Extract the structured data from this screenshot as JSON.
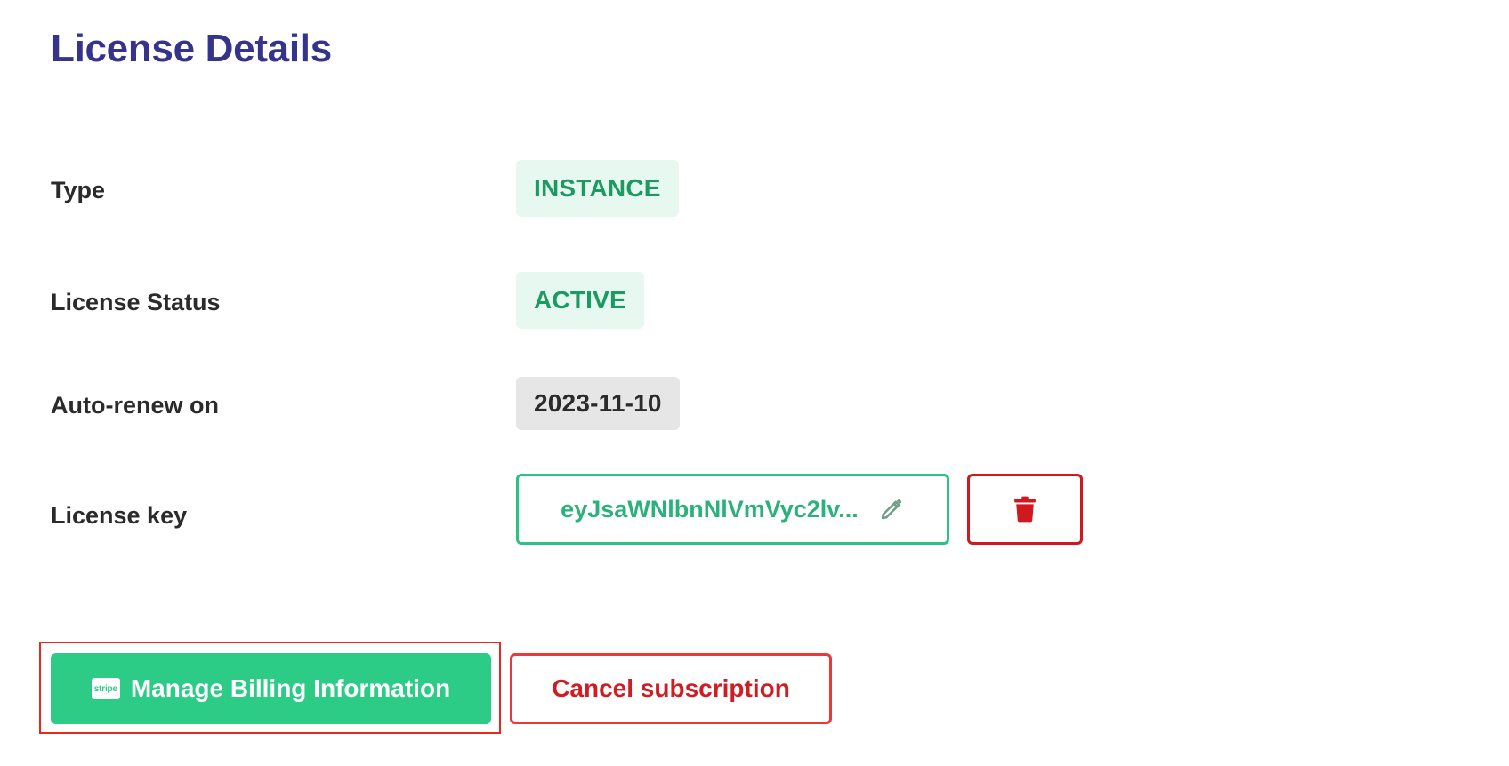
{
  "page": {
    "title": "License Details"
  },
  "details": {
    "type": {
      "label": "Type",
      "value": "INSTANCE"
    },
    "status": {
      "label": "License Status",
      "value": "ACTIVE"
    },
    "renew": {
      "label": "Auto-renew on",
      "value": "2023-11-10"
    },
    "key": {
      "label": "License key",
      "value": "eyJsaWNlbnNlVmVyc2lv..."
    }
  },
  "actions": {
    "stripe_icon_text": "stripe",
    "manage_billing_label": "Manage Billing Information",
    "cancel_label": "Cancel subscription"
  },
  "icons": {
    "edit": "pencil-icon",
    "delete": "trash-icon",
    "billing": "stripe-icon"
  },
  "colors": {
    "title": "#35348a",
    "accent_green": "#2ccc87",
    "pill_green_bg": "#e7f8f0",
    "pill_green_text": "#1c9a62",
    "danger_red": "#cf1d23",
    "date_pill_bg": "#e6e6e6"
  }
}
